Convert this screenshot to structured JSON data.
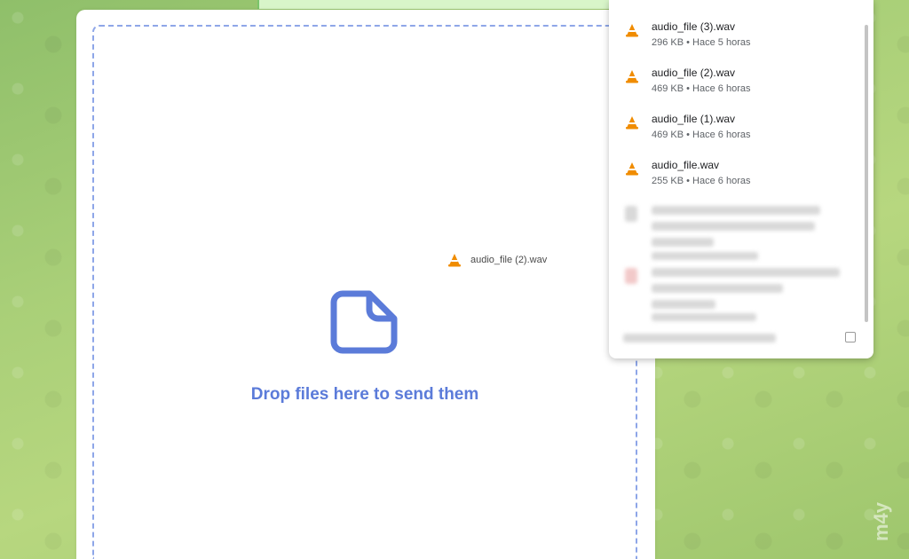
{
  "drop_zone": {
    "message": "Drop files here to send them"
  },
  "drag_ghost": {
    "file_name": "audio_file (2).wav"
  },
  "downloads": {
    "items": [
      {
        "name": "audio_file (3).wav",
        "meta": "296 KB • Hace 5 horas"
      },
      {
        "name": "audio_file (2).wav",
        "meta": "469 KB • Hace 6 horas"
      },
      {
        "name": "audio_file (1).wav",
        "meta": "469 KB • Hace 6 horas"
      },
      {
        "name": "audio_file.wav",
        "meta": "255 KB • Hace 6 horas"
      }
    ]
  },
  "watermark": {
    "text": "m4y"
  },
  "colors": {
    "accent": "#5b7bd9",
    "vlc_orange": "#f08c00"
  }
}
